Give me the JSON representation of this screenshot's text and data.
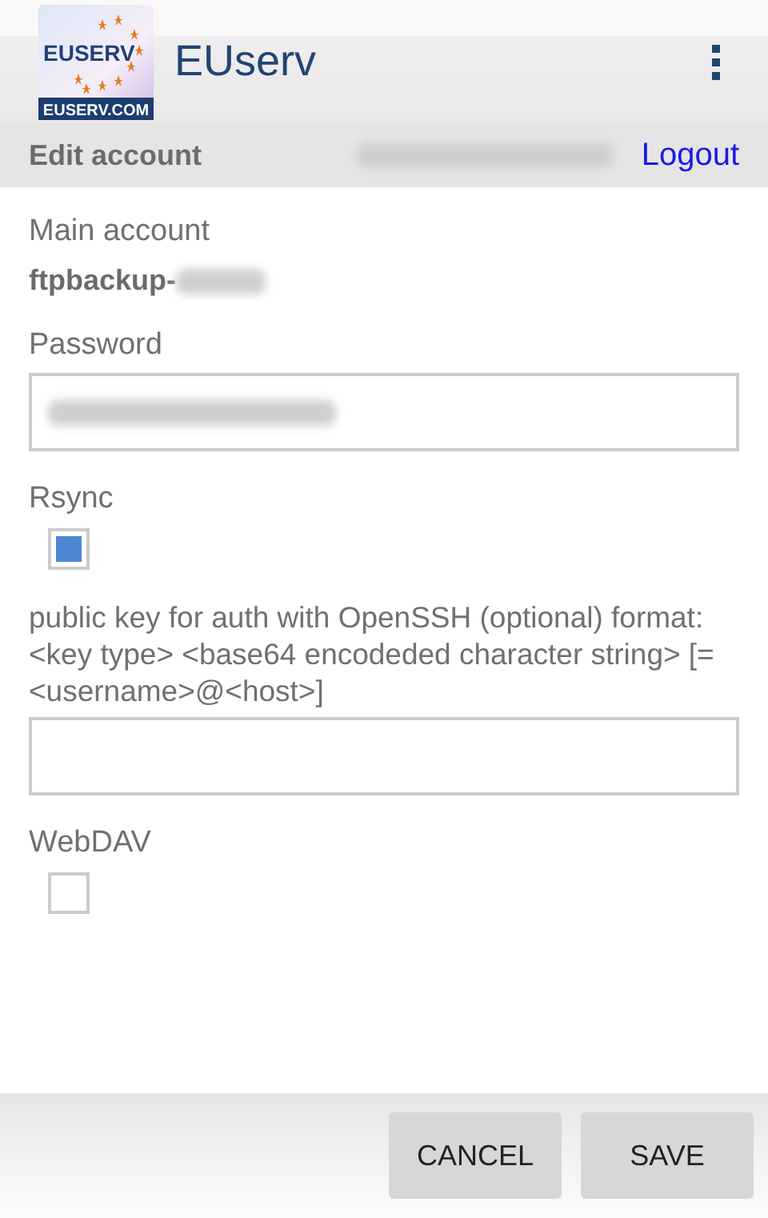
{
  "app_bar": {
    "logo": {
      "brand": "EUSERV",
      "domain": "EUSERV.COM"
    },
    "title": "EUserv"
  },
  "sub_bar": {
    "title": "Edit account",
    "user_name_redacted": true,
    "logout": "Logout"
  },
  "form": {
    "main_account": {
      "label": "Main account",
      "value": "ftpbackup-",
      "value_redacted": true
    },
    "password": {
      "label": "Password",
      "value_redacted": true
    },
    "rsync": {
      "label": "Rsync",
      "checked": true
    },
    "public_key": {
      "label": "public key for auth with OpenSSH (optional) format: <key type> <base64 encodeded character string> [= <username>@<host>]"
    },
    "webdav": {
      "label": "WebDAV",
      "checked": false
    }
  },
  "buttons": [
    {
      "label": "CANCEL"
    },
    {
      "label": "SAVE"
    }
  ]
}
